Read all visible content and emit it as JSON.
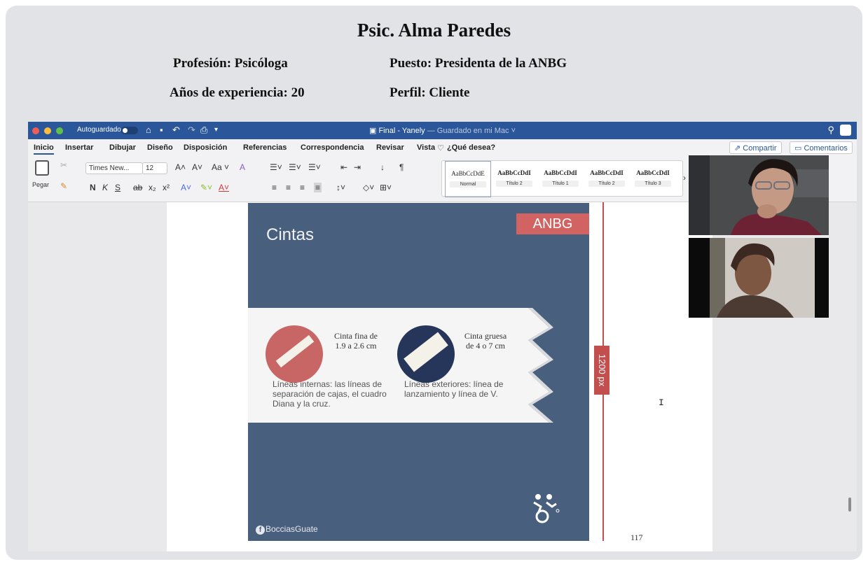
{
  "header": {
    "name": "Psic. Alma Paredes",
    "profesion": "Profesión: Psicóloga",
    "puesto": "Puesto:  Presidenta de la ANBG",
    "anios": "Años de experiencia: 20",
    "perfil": "Perfil: Cliente"
  },
  "word": {
    "titlebar": {
      "autosave_label": "Autoguardado",
      "doc_title": "Final - Yanely",
      "doc_status": " — Guardado en mi Mac ˅"
    },
    "menu": [
      "Inicio",
      "Insertar",
      "Dibujar",
      "Diseño",
      "Disposición",
      "Referencias",
      "Correspondencia",
      "Revisar",
      "Vista"
    ],
    "search_placeholder": "¿Qué desea?",
    "share_label": "Compartir",
    "comments_label": "Comentarios",
    "ribbon": {
      "paste_label": "Pegar",
      "font_name": "Times New...",
      "font_size": "12",
      "bold": "N",
      "italic": "K",
      "underline": "S"
    },
    "styles": [
      {
        "sample": "AaBbCcDdE",
        "name": "Normal"
      },
      {
        "sample": "AaBbCcDdI",
        "name": "Título 2"
      },
      {
        "sample": "AaBbCcDdI",
        "name": "Título 1"
      },
      {
        "sample": "AaBbCcDdI",
        "name": "Título 2"
      },
      {
        "sample": "AaBbCcDdI",
        "name": "Título 3"
      }
    ]
  },
  "slide": {
    "title": "Cintas",
    "badge": "ANBG",
    "fina_label_1": "Cinta fina de",
    "fina_label_2": "1.9 a 2.6 cm",
    "gruesa_label_1": "Cinta gruesa",
    "gruesa_label_2": "de 4 o 7 cm",
    "fina_desc": "Líneas internas: las líneas de separación de cajas, el cuadro Diana y la cruz.",
    "gruesa_desc": "Líneas exteriores: línea de lanzamiento y línea de V.",
    "footer": "BocciasGuate",
    "ruler_label": "1200 px"
  },
  "page_number": "117",
  "colors": {
    "word_blue": "#2b579a",
    "slide_bg": "#48607e",
    "accent_red": "#d16363",
    "dark_navy": "#26365b"
  }
}
